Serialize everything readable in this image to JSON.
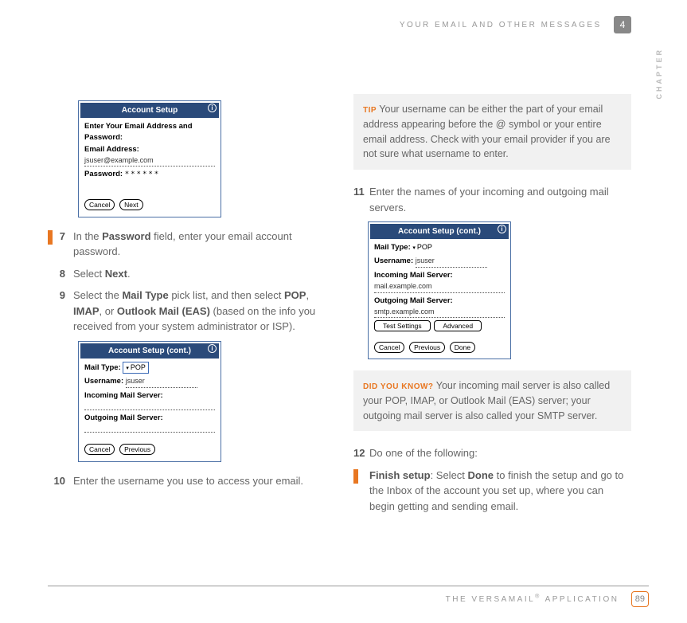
{
  "header": {
    "section": "YOUR EMAIL AND OTHER MESSAGES",
    "chapter_num": "4",
    "chapter_label": "CHAPTER"
  },
  "screenshots": {
    "s1": {
      "title": "Account Setup",
      "intro": "Enter Your Email Address and Password:",
      "email_label": "Email Address:",
      "email_value": "jsuser@example.com",
      "password_label": "Password:",
      "password_value": "******",
      "btn_cancel": "Cancel",
      "btn_next": "Next"
    },
    "s2": {
      "title": "Account Setup (cont.)",
      "mailtype_label": "Mail Type:",
      "mailtype_value": "POP",
      "username_label": "Username:",
      "username_value": "jsuser",
      "incoming_label": "Incoming Mail Server:",
      "outgoing_label": "Outgoing Mail Server:",
      "btn_cancel": "Cancel",
      "btn_previous": "Previous"
    },
    "s3": {
      "title": "Account Setup (cont.)",
      "mailtype_label": "Mail Type:",
      "mailtype_value": "POP",
      "username_label": "Username:",
      "username_value": "jsuser",
      "incoming_label": "Incoming Mail Server:",
      "incoming_value": "mail.example.com",
      "outgoing_label": "Outgoing Mail Server:",
      "outgoing_value": "smtp.example.com",
      "btn_test": "Test Settings",
      "btn_advanced": "Advanced",
      "btn_cancel": "Cancel",
      "btn_previous": "Previous",
      "btn_done": "Done"
    }
  },
  "steps": {
    "n7": "7",
    "t7a": "In the ",
    "t7b": "Password",
    "t7c": " field, enter your email account password.",
    "n8": "8",
    "t8a": " Select ",
    "t8b": "Next",
    "t8c": ".",
    "n9": "9",
    "t9a": "Select the ",
    "t9b": "Mail Type",
    "t9c": " pick list, and then select ",
    "t9d": "POP",
    "t9e": ", ",
    "t9f": "IMAP",
    "t9g": ", or ",
    "t9h": "Outlook Mail (EAS)",
    "t9i": " (based on the info you received from your system administrator or ISP).",
    "n10": "10",
    "t10": "Enter the username you use to access your email.",
    "n11": "11",
    "t11": "Enter the names of your incoming and outgoing mail servers.",
    "n12": "12",
    "t12": "Do one of the following:",
    "t12sa": "Finish setup",
    "t12sb": ": Select ",
    "t12sc": "Done",
    "t12sd": " to finish the setup and go to the Inbox of the account you set up, where you can begin getting and sending email."
  },
  "tips": {
    "tip_label": "TIP",
    "tip_text": "  Your username can be either the part of your email address appearing before the @ symbol or your entire email address. Check with your email provider if you are not sure what username to enter.",
    "dyk_label": "DID YOU KNOW?",
    "dyk_text": "  Your incoming mail server is also called your POP, IMAP, or Outlook Mail (EAS) server; your outgoing mail server is also called your SMTP server."
  },
  "footer": {
    "text": "THE VERSAMAIL",
    "reg": "®",
    "text2": " APPLICATION",
    "page": "89"
  }
}
